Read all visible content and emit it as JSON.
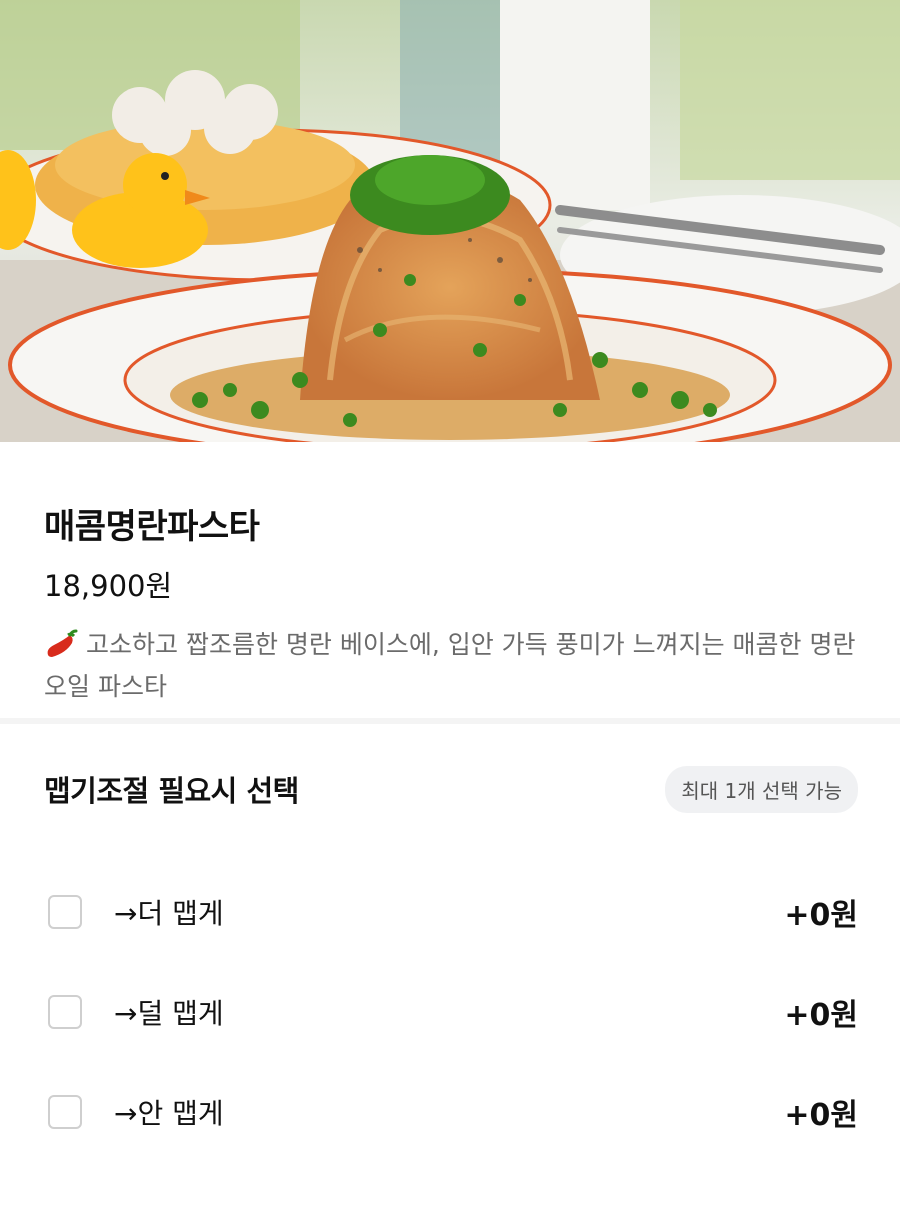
{
  "product": {
    "image_alt": "spicy mentaiko pasta photo",
    "name": "매콤명란파스타",
    "price": "18,900원",
    "description": "고소하고 짭조름한 명란 베이스에, 입안 가득 풍미가 느껴지는 매콤한 명란오일 파스타",
    "description_icon": "chili-pepper-icon"
  },
  "option_group": {
    "title": "맵기조절 필요시 선택",
    "badge": "최대 1개 선택 가능",
    "items": [
      {
        "label": "→더 맵게",
        "price": "+0원",
        "checked": false
      },
      {
        "label": "→덜 맵게",
        "price": "+0원",
        "checked": false
      },
      {
        "label": "→안 맵게",
        "price": "+0원",
        "checked": false
      }
    ]
  },
  "colors": {
    "plate_rim": "#e2582a",
    "herb_green": "#3c8a1f",
    "duck_yellow": "#ffc21a"
  }
}
